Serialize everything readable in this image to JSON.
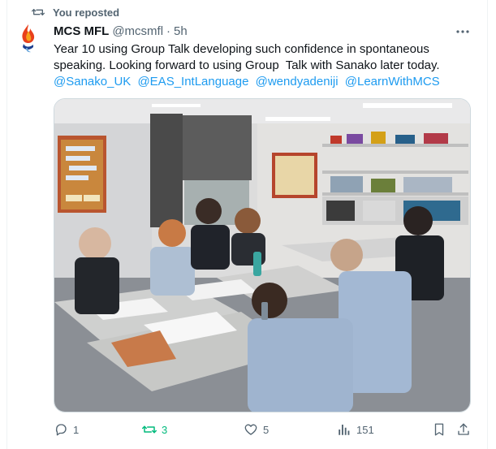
{
  "repost": {
    "label": "You reposted"
  },
  "author": {
    "name": "MCS MFL",
    "handle": "@mcsmfl",
    "separator": "·",
    "time": "5h"
  },
  "tweet": {
    "line1": "Year 10 using Group Talk developing such confidence in spontaneous",
    "line2": "speaking. Looking forward to using Group  Talk with Sanako later today.",
    "mentions": [
      "@Sanako_UK",
      "@EAS_IntLanguage",
      "@wendyadeniji",
      "@LearnWithMCS"
    ]
  },
  "media": {
    "description_icon": "photo"
  },
  "actions": {
    "reply_count": "1",
    "repost_count": "3",
    "like_count": "5",
    "views_count": "151"
  },
  "colors": {
    "accent": "#1d9bf0",
    "repost_green": "#00ba7c",
    "muted": "#536471"
  }
}
